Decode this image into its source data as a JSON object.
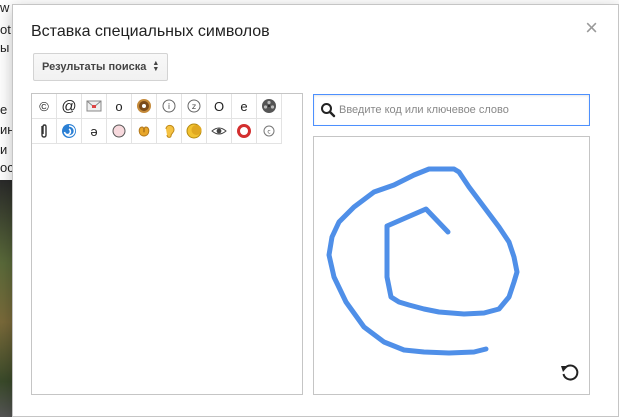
{
  "dialog": {
    "title": "Вставка специальных символов",
    "close_label": "×",
    "category_dropdown": "Результаты поиска",
    "search": {
      "placeholder": "Введите код или ключевое слово",
      "value": ""
    }
  },
  "symbols": [
    {
      "type": "text",
      "char": "©",
      "name": "copyright-symbol"
    },
    {
      "type": "text",
      "char": "@",
      "name": "at-symbol"
    },
    {
      "type": "icon",
      "icon": "envelope-icon",
      "name": "envelope-symbol"
    },
    {
      "type": "text",
      "char": "o",
      "name": "letter-o-symbol"
    },
    {
      "type": "icon",
      "icon": "donut-icon",
      "name": "donut-symbol"
    },
    {
      "type": "icon",
      "icon": "circled-i-icon",
      "name": "circled-i-symbol"
    },
    {
      "type": "icon",
      "icon": "circled-z-icon",
      "name": "circled-z-symbol"
    },
    {
      "type": "text",
      "char": "O",
      "name": "capital-o-symbol"
    },
    {
      "type": "text",
      "char": "e",
      "name": "letter-e-symbol"
    },
    {
      "type": "icon",
      "icon": "film-reel-icon",
      "name": "film-reel-symbol"
    },
    {
      "type": "icon",
      "icon": "paperclip-icon",
      "name": "paperclip-symbol"
    },
    {
      "type": "icon",
      "icon": "cyclone-icon",
      "name": "cyclone-symbol"
    },
    {
      "type": "text",
      "char": "ә",
      "name": "schwa-symbol"
    },
    {
      "type": "icon",
      "icon": "pink-circle-icon",
      "name": "pink-circle-symbol"
    },
    {
      "type": "icon",
      "icon": "pretzel-icon",
      "name": "pretzel-symbol"
    },
    {
      "type": "icon",
      "icon": "ear-icon",
      "name": "ear-symbol"
    },
    {
      "type": "icon",
      "icon": "moon-icon",
      "name": "moon-symbol"
    },
    {
      "type": "icon",
      "icon": "eye-icon",
      "name": "eye-symbol"
    },
    {
      "type": "icon",
      "icon": "red-ring-icon",
      "name": "red-ring-symbol"
    },
    {
      "type": "icon",
      "icon": "circled-c-icon",
      "name": "circled-c-symbol"
    }
  ],
  "colors": {
    "stroke": "#4f8fe8",
    "focus_border": "#4d90fe"
  },
  "drawing": {
    "icon_undo": "undo-icon"
  },
  "background_page": {
    "lines": [
      "w",
      "ot",
      "ы",
      "е",
      "ин",
      "и",
      "ос"
    ]
  }
}
